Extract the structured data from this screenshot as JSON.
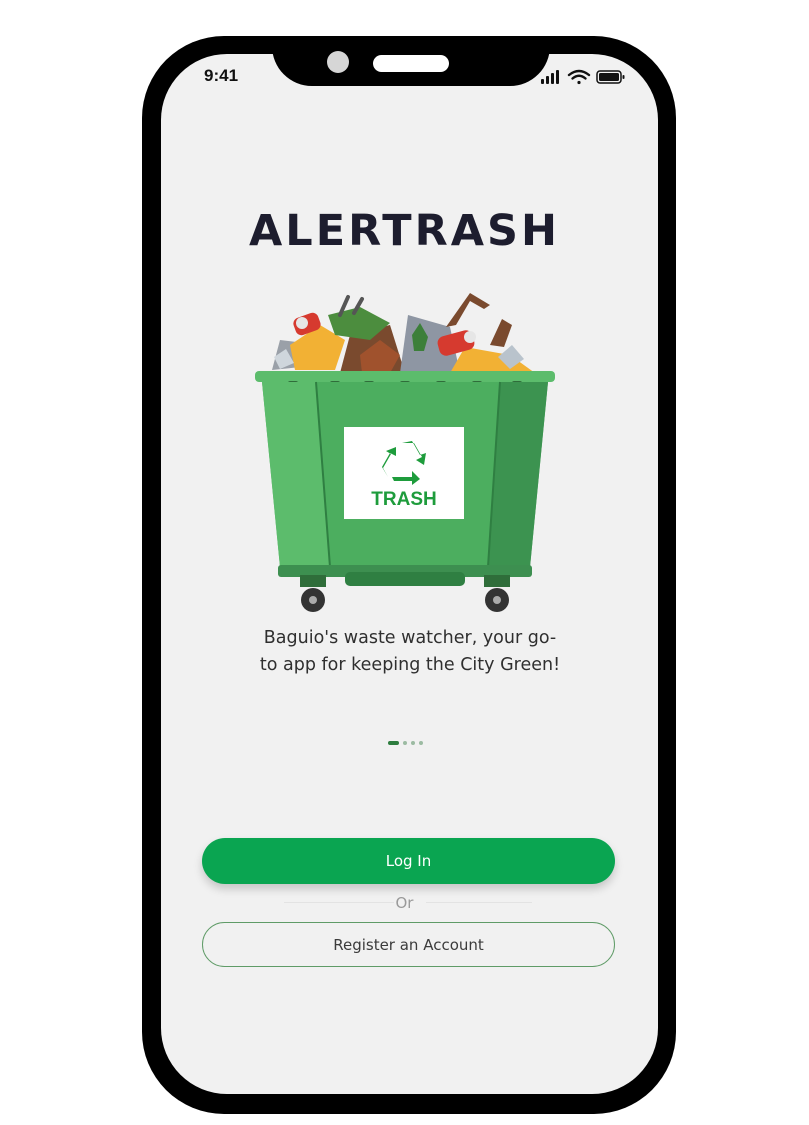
{
  "status_bar": {
    "time": "9:41",
    "icons": [
      "signal-icon",
      "wifi-icon",
      "battery-icon"
    ]
  },
  "app": {
    "title": "ALERTRASH",
    "tagline_line1": "Baguio's waste watcher, your go-",
    "tagline_line2": "to app for keeping the City Green!"
  },
  "illustration": {
    "sign_text": "TRASH",
    "icon": "recycle-icon"
  },
  "pager": {
    "total": 4,
    "active_index": 0
  },
  "actions": {
    "login_label": "Log In",
    "divider_label": "Or",
    "register_label": "Register an Account"
  },
  "colors": {
    "primary": "#0aa551",
    "dumpster": "#4cae5f",
    "logo": "#1d1d2e",
    "background": "#f1f1f1"
  }
}
